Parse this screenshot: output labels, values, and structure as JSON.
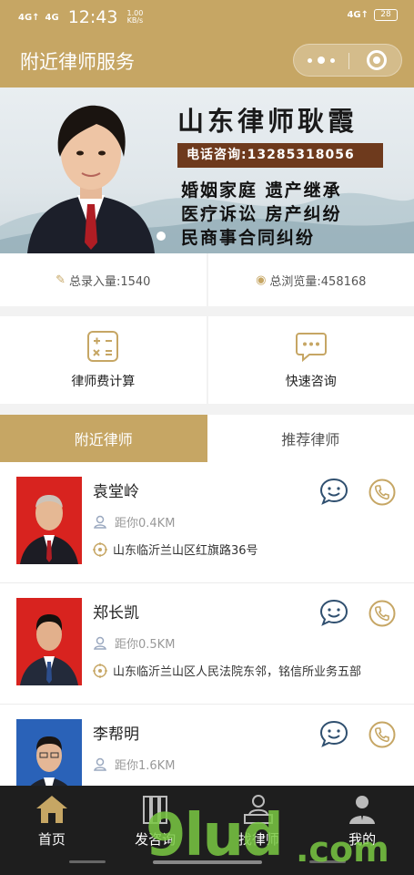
{
  "status_bar": {
    "signal1": "4G↑",
    "signal2": "4G",
    "time": "12:43",
    "speed_value": "1.00",
    "speed_unit": "KB/s",
    "signal_right": "4G↑",
    "battery": "28"
  },
  "title_bar": {
    "title": "附近律师服务"
  },
  "banner": {
    "name": "山东律师耿霞",
    "phone": "电话咨询:13285318056",
    "services": [
      "婚姻家庭  遗产继承",
      "医疗诉讼  房产纠纷",
      "民商事合同纠纷"
    ]
  },
  "stats": {
    "entries": "总录入量:1540",
    "views": "总浏览量:458168"
  },
  "tools": {
    "fee_calc": "律师费计算",
    "quick_consult": "快速咨询"
  },
  "tabs": {
    "nearby": "附近律师",
    "recommended": "推荐律师"
  },
  "lawyers": [
    {
      "name": "袁堂岭",
      "distance": "距你0.4KM",
      "address": "山东临沂兰山区红旗路36号"
    },
    {
      "name": "郑长凯",
      "distance": "距你0.5KM",
      "address": "山东临沂兰山区人民法院东邻，铭信所业务五部"
    },
    {
      "name": "李帮明",
      "distance": "距你1.6KM",
      "address": ""
    }
  ],
  "bottom_nav": {
    "home": "首页",
    "consult": "发咨询",
    "find": "找律师",
    "mine": "我的"
  },
  "watermark": {
    "text": "9lud",
    "suffix": ".com"
  },
  "colors": {
    "accent": "#c6a664",
    "nav_bg": "#1e1e1e",
    "chat_icon": "#2f4f6f"
  }
}
